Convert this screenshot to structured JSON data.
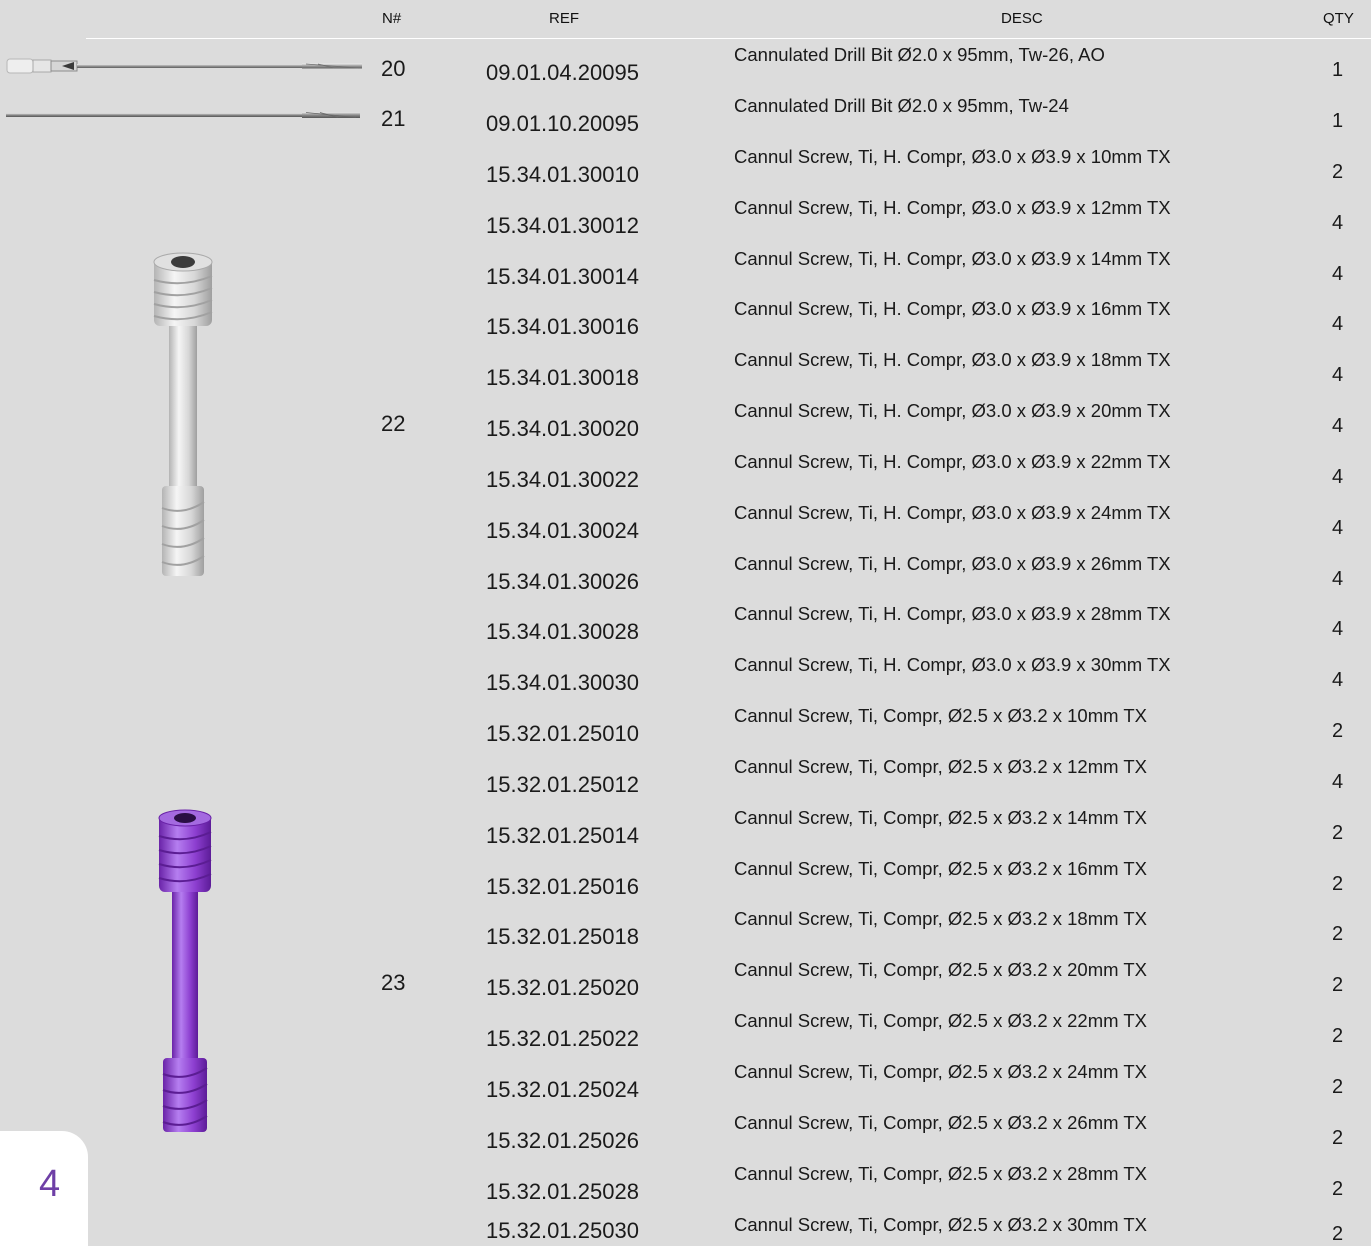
{
  "header": {
    "n": "N#",
    "ref": "REF",
    "desc": "DESC",
    "qty": "QTY"
  },
  "groups": [
    {
      "n": "20",
      "image": "cannulated-drill-bit-ao"
    },
    {
      "n": "21",
      "image": "cannulated-drill-bit"
    },
    {
      "n": "22",
      "image": "silver-cannulated-screw"
    },
    {
      "n": "23",
      "image": "purple-cannulated-screw"
    }
  ],
  "rows": [
    {
      "ref": "09.01.04.20095",
      "desc": "Cannulated Drill Bit Ø2.0 x 95mm, Tw-26, AO",
      "qty": "1"
    },
    {
      "ref": "09.01.10.20095",
      "desc": "Cannulated Drill Bit Ø2.0 x 95mm, Tw-24",
      "qty": "1"
    },
    {
      "ref": "15.34.01.30010",
      "desc": "Cannul Screw, Ti, H. Compr, Ø3.0 x Ø3.9 x 10mm TX",
      "qty": "2"
    },
    {
      "ref": "15.34.01.30012",
      "desc": "Cannul Screw, Ti, H. Compr, Ø3.0 x Ø3.9 x 12mm TX",
      "qty": "4"
    },
    {
      "ref": "15.34.01.30014",
      "desc": "Cannul Screw, Ti, H. Compr, Ø3.0 x Ø3.9 x 14mm TX",
      "qty": "4"
    },
    {
      "ref": "15.34.01.30016",
      "desc": "Cannul Screw, Ti, H. Compr, Ø3.0 x Ø3.9 x 16mm TX",
      "qty": "4"
    },
    {
      "ref": "15.34.01.30018",
      "desc": "Cannul Screw, Ti, H. Compr, Ø3.0 x Ø3.9 x 18mm TX",
      "qty": "4"
    },
    {
      "ref": "15.34.01.30020",
      "desc": "Cannul Screw, Ti, H. Compr, Ø3.0 x Ø3.9 x 20mm TX",
      "qty": "4"
    },
    {
      "ref": "15.34.01.30022",
      "desc": "Cannul Screw, Ti, H. Compr, Ø3.0 x Ø3.9 x 22mm TX",
      "qty": "4"
    },
    {
      "ref": "15.34.01.30024",
      "desc": "Cannul Screw, Ti, H. Compr, Ø3.0 x Ø3.9 x 24mm TX",
      "qty": "4"
    },
    {
      "ref": "15.34.01.30026",
      "desc": "Cannul Screw, Ti, H. Compr, Ø3.0 x Ø3.9 x 26mm TX",
      "qty": "4"
    },
    {
      "ref": "15.34.01.30028",
      "desc": "Cannul Screw, Ti, H. Compr, Ø3.0 x Ø3.9 x 28mm TX",
      "qty": "4"
    },
    {
      "ref": "15.34.01.30030",
      "desc": "Cannul Screw, Ti, H. Compr, Ø3.0 x Ø3.9 x 30mm TX",
      "qty": "4"
    },
    {
      "ref": "15.32.01.25010",
      "desc": "Cannul Screw, Ti, Compr, Ø2.5 x Ø3.2 x 10mm TX",
      "qty": "2"
    },
    {
      "ref": "15.32.01.25012",
      "desc": "Cannul Screw, Ti, Compr, Ø2.5 x Ø3.2 x 12mm TX",
      "qty": "4"
    },
    {
      "ref": "15.32.01.25014",
      "desc": "Cannul Screw, Ti, Compr, Ø2.5 x Ø3.2 x 14mm TX",
      "qty": "2"
    },
    {
      "ref": "15.32.01.25016",
      "desc": "Cannul Screw, Ti, Compr, Ø2.5 x Ø3.2 x 16mm TX",
      "qty": "2"
    },
    {
      "ref": "15.32.01.25018",
      "desc": "Cannul Screw, Ti, Compr, Ø2.5 x Ø3.2 x 18mm TX",
      "qty": "2"
    },
    {
      "ref": "15.32.01.25020",
      "desc": "Cannul Screw, Ti, Compr, Ø2.5 x Ø3.2 x 20mm TX",
      "qty": "2"
    },
    {
      "ref": "15.32.01.25022",
      "desc": "Cannul Screw, Ti, Compr, Ø2.5 x Ø3.2 x 22mm TX",
      "qty": "2"
    },
    {
      "ref": "15.32.01.25024",
      "desc": "Cannul Screw, Ti, Compr, Ø2.5 x Ø3.2 x 24mm TX",
      "qty": "2"
    },
    {
      "ref": "15.32.01.25026",
      "desc": "Cannul Screw, Ti, Compr, Ø2.5 x Ø3.2 x 26mm TX",
      "qty": "2"
    },
    {
      "ref": "15.32.01.25028",
      "desc": "Cannul Screw, Ti, Compr, Ø2.5 x Ø3.2 x 28mm TX",
      "qty": "2"
    },
    {
      "ref": "15.32.01.25030",
      "desc": "Cannul Screw, Ti, Compr, Ø2.5 x Ø3.2 x 30mm TX",
      "qty": "2"
    }
  ],
  "page_number": "4",
  "colors": {
    "background": "#dcdcdc",
    "page_tab": "#ffffff",
    "page_number": "#6e3fa6",
    "purple_screw": "#8d3fd0",
    "silver_screw": "#d9d9d9"
  }
}
